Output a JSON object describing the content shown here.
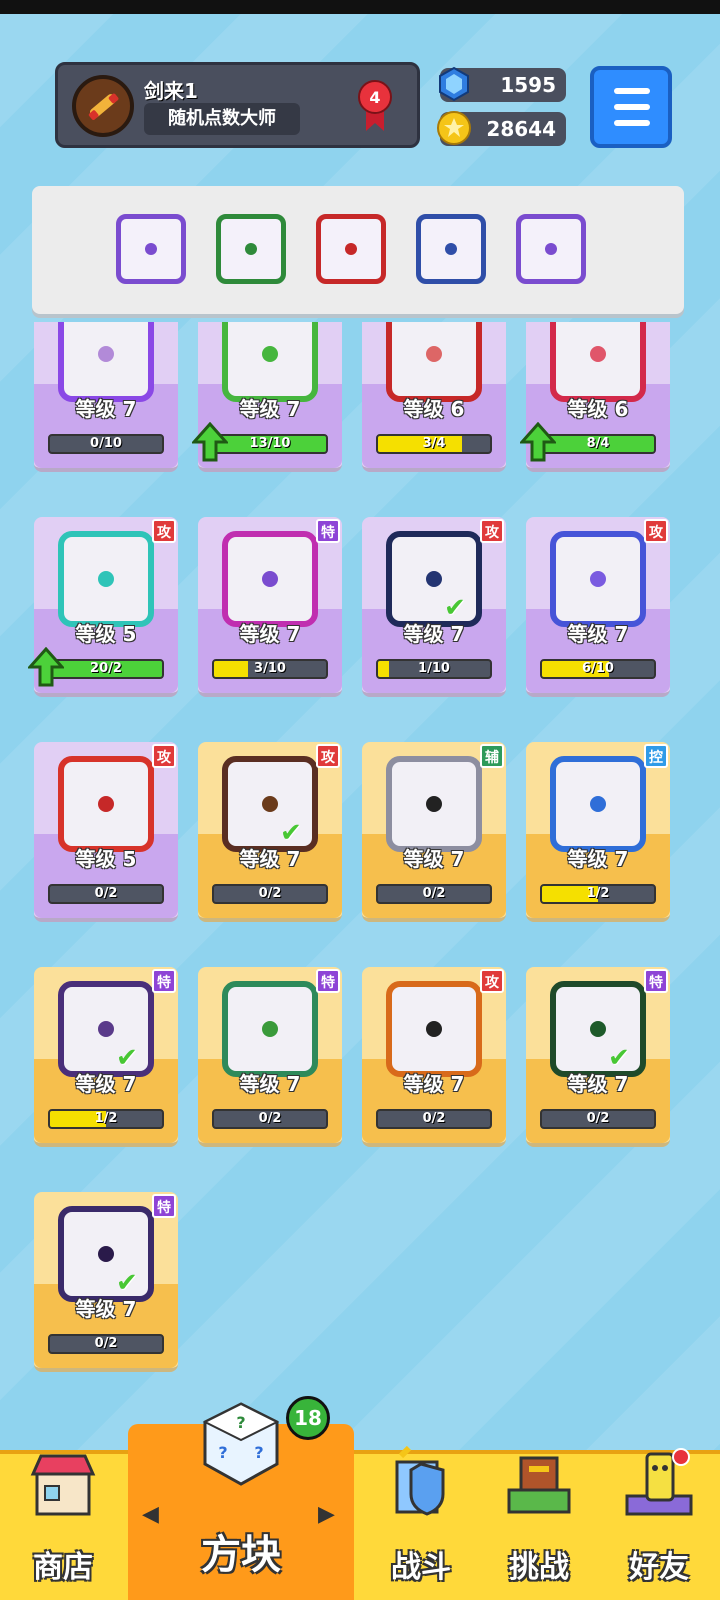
{
  "profile": {
    "name": "剑来1",
    "title": "随机点数大师",
    "rank": "4"
  },
  "currency": {
    "gems": "1595",
    "coins": "28644"
  },
  "deck": [
    {
      "color": "#7a4ccf",
      "pip": "#7a4ccf",
      "icon": "dragon-dice-icon"
    },
    {
      "color": "#2e8a3a",
      "pip": "#2e8a3a",
      "icon": "dragon-dice-icon"
    },
    {
      "color": "#c62828",
      "pip": "#c62828",
      "icon": "dragon-dice-icon"
    },
    {
      "color": "#2f4ea8",
      "pip": "#2f4ea8",
      "icon": "gear-dice-icon"
    },
    {
      "color": "#7a4ccf",
      "pip": "#7a4ccf",
      "icon": "dragon-dice-icon"
    }
  ],
  "cards": [
    {
      "level": "等级 7",
      "progress": "0/10",
      "fill": 0,
      "theme": "purple",
      "border": "#8a48e6",
      "pip": "#b28ad8",
      "badge": "",
      "badgeColor": "",
      "check": false,
      "arrow": false,
      "icon": "rainbow-dice-icon"
    },
    {
      "level": "等级 7",
      "progress": "13/10",
      "fill": 1,
      "theme": "purple",
      "border": "#46b63e",
      "pip": "#46b63e",
      "badge": "",
      "badgeColor": "",
      "check": false,
      "arrow": true,
      "icon": "plant-dice-icon"
    },
    {
      "level": "等级 6",
      "progress": "3/4",
      "fill": 0.75,
      "theme": "purple",
      "border": "#c62828",
      "pip": "#d66",
      "badge": "",
      "badgeColor": "",
      "check": false,
      "arrow": false,
      "icon": "crack-dice-icon"
    },
    {
      "level": "等级 6",
      "progress": "8/4",
      "fill": 1,
      "theme": "purple",
      "border": "#d3294a",
      "pip": "#e0566a",
      "badge": "",
      "badgeColor": "",
      "check": false,
      "arrow": true,
      "icon": "cross-dice-icon"
    },
    {
      "level": "等级 5",
      "progress": "20/2",
      "fill": 1,
      "theme": "purple",
      "border": "#2fc4b8",
      "pip": "#2fc4b8",
      "badge": "攻",
      "badgeColor": "#e03a3a",
      "check": false,
      "arrow": true,
      "icon": "wind-dice-icon"
    },
    {
      "level": "等级 7",
      "progress": "3/10",
      "fill": 0.3,
      "theme": "purple",
      "border": "#c02eb0",
      "pip": "#7a4ccf",
      "badge": "特",
      "badgeColor": "#8e44d6",
      "check": false,
      "arrow": false,
      "icon": "swap-dice-icon"
    },
    {
      "level": "等级 7",
      "progress": "1/10",
      "fill": 0.1,
      "theme": "purple",
      "border": "#1f2a5a",
      "pip": "#243572",
      "badge": "攻",
      "badgeColor": "#e03a3a",
      "check": true,
      "arrow": false,
      "icon": "gear-dice-icon"
    },
    {
      "level": "等级 7",
      "progress": "6/10",
      "fill": 0.6,
      "theme": "purple",
      "border": "#4654d8",
      "pip": "#7a5be0",
      "badge": "攻",
      "badgeColor": "#e03a3a",
      "check": false,
      "arrow": false,
      "icon": "bubble-dice-icon"
    },
    {
      "level": "等级 5",
      "progress": "0/2",
      "fill": 0,
      "theme": "purple",
      "border": "#d7332a",
      "pip": "#c62828",
      "badge": "攻",
      "badgeColor": "#e03a3a",
      "check": false,
      "arrow": false,
      "icon": "fire-dice-icon"
    },
    {
      "level": "等级 7",
      "progress": "0/2",
      "fill": 0,
      "theme": "gold",
      "border": "#5a2e22",
      "pip": "#6b3b1b",
      "badge": "攻",
      "badgeColor": "#e03a3a",
      "check": true,
      "arrow": false,
      "icon": "star-dice-icon"
    },
    {
      "level": "等级 7",
      "progress": "0/2",
      "fill": 0,
      "theme": "gold",
      "border": "#8d8ea0",
      "pip": "#222",
      "badge": "辅",
      "badgeColor": "#2e9a5a",
      "check": false,
      "arrow": false,
      "icon": "fang-dice-icon"
    },
    {
      "level": "等级 7",
      "progress": "1/2",
      "fill": 0.5,
      "theme": "gold",
      "border": "#2f6ed8",
      "pip": "#2f6ed8",
      "badge": "控",
      "badgeColor": "#2f9be8",
      "check": false,
      "arrow": false,
      "icon": "snowflake-dice-icon"
    },
    {
      "level": "等级 7",
      "progress": "1/2",
      "fill": 0.5,
      "theme": "gold",
      "border": "#4a2f7a",
      "pip": "#5a3a8a",
      "badge": "特",
      "badgeColor": "#8e44d6",
      "check": true,
      "arrow": false,
      "icon": "cycle-dice-icon"
    },
    {
      "level": "等级 7",
      "progress": "0/2",
      "fill": 0,
      "theme": "gold",
      "border": "#2e8a5a",
      "pip": "#3a9a3a",
      "badge": "特",
      "badgeColor": "#8e44d6",
      "check": false,
      "arrow": false,
      "icon": "pentagram-dice-icon"
    },
    {
      "level": "等级 7",
      "progress": "0/2",
      "fill": 0,
      "theme": "gold",
      "border": "#d86a1a",
      "pip": "#222",
      "badge": "攻",
      "badgeColor": "#e03a3a",
      "check": false,
      "arrow": false,
      "icon": "gun-dice-icon"
    },
    {
      "level": "等级 7",
      "progress": "0/2",
      "fill": 0,
      "theme": "gold",
      "border": "#1f4a2a",
      "pip": "#1e5a2a",
      "badge": "特",
      "badgeColor": "#8e44d6",
      "check": true,
      "arrow": false,
      "icon": "grass-dice-icon"
    },
    {
      "level": "等级 7",
      "progress": "0/2",
      "fill": 0,
      "theme": "gold",
      "border": "#3a2a6a",
      "pip": "#2a1a4a",
      "badge": "特",
      "badgeColor": "#8e44d6",
      "check": true,
      "arrow": false,
      "icon": "void-dice-icon"
    }
  ],
  "nav": {
    "shop": "商店",
    "dice": "方块",
    "battle": "战斗",
    "challenge": "挑战",
    "friends": "好友",
    "badge": "18"
  }
}
